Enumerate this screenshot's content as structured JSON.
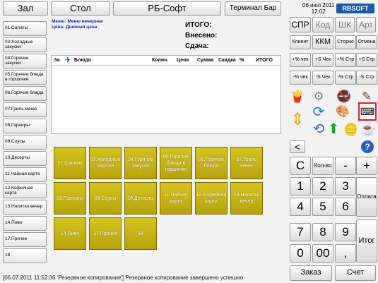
{
  "top_bar": {
    "hall": "Зал",
    "table": "Стол",
    "brand": "РБ-Софт",
    "terminal": "Терминал Бар"
  },
  "datetime": {
    "date": "06 июл 2011",
    "time": "12:02"
  },
  "logo": "RBSOFT",
  "menu_info": {
    "menu": "Меню: Меню вечернее",
    "price": "Цена: Дневная цена"
  },
  "totals": {
    "total": "ИТОГО:",
    "paid": "Внесено:",
    "change": "Сдача:"
  },
  "categories": [
    "01.Салаты",
    "03.Холодные закуски",
    "04.Горячие закуски",
    "05.Горячие блюда в горшочке",
    "06.Горячие блюда",
    "07.Гриль меню",
    "08.Гарниры",
    "09.Соусы",
    "10.Десерты",
    "11.Чайная карта",
    "12.Кофейная карта",
    "13.Напитки вечер",
    "14.Пиво",
    "17.Прочее",
    "18"
  ],
  "order_columns": {
    "num": "№",
    "dish": "Блюдо",
    "qty": "Колич.",
    "price": "Цена",
    "sum": "Сумма",
    "discount": "Скидка",
    "percent": "%",
    "total": "ИТОГО"
  },
  "dish_buttons": [
    "01.Салаты",
    "03.Холодные закуски",
    "04.Горячие закуски",
    "05.Горячие блюда в горшочке",
    "06.Горячие блюда",
    "07.Гриль меню",
    "08.Гарниры",
    "09.Соусы",
    "10.Десерты",
    "11.Чайная карта",
    "12.Кофейная карта",
    "13.Напитки вечер",
    "14.Пиво",
    "17.Прочее",
    "18"
  ],
  "status_text": "[06.07.2011 11:52:36 'Резервное копирование'] Резервное копирование завершено успешно",
  "mode_buttons": {
    "spr": "СПР",
    "kod": "Код",
    "shk": "ШК",
    "art": "Арт"
  },
  "function_buttons": {
    "client": "Клиент",
    "kkm": "ККМ",
    "storno": "Сторно",
    "cancel": "Отмена",
    "plus_pct_check": "+% чек",
    "plus_s_check": "+S Чек",
    "plus_pct_line": "+% Стр",
    "plus_s_line": "+S Стр",
    "minus_pct_check": "-% чек",
    "minus_s_check": "-S Чек",
    "minus_pct_line": "-% Стр",
    "minus_s_line": "-S Стр"
  },
  "keypad": {
    "clear": "С",
    "qty": "Кол-во",
    "minus": "-",
    "plus": "+",
    "d1": "1",
    "d2": "2",
    "d3": "3",
    "d4": "4",
    "d5": "5",
    "d6": "6",
    "d7": "7",
    "d8": "8",
    "d9": "9",
    "d0": "0",
    "d00": "00",
    "dot": ",",
    "pay": "Оплата",
    "total": "Итог"
  },
  "bottom_buttons": {
    "order": "Заказ",
    "bill": "Счет"
  },
  "icons": {
    "fries": "fries-icon",
    "gear": "gear-icon",
    "no_smoking": "no-smoking-icon",
    "pencil": "pencil-icon",
    "arrows_updown": "up-down-arrows-icon",
    "refresh": "refresh-arrows-icon",
    "palette": "palette-icon",
    "keyboard": "keyboard-icon",
    "arrow_up": "green-arrow-up-icon",
    "coins": "coins-icon",
    "back": "back-arrow-icon",
    "help": "help-icon"
  }
}
